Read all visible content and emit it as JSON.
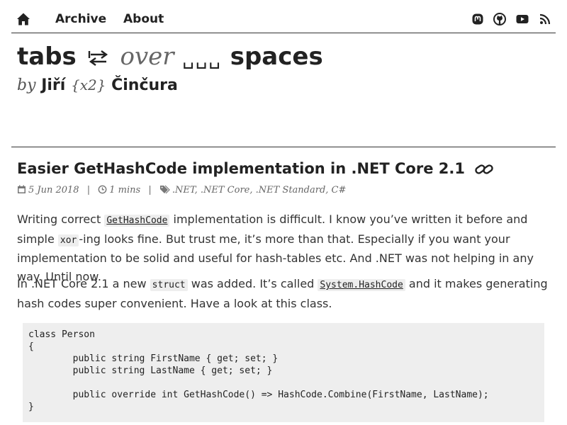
{
  "nav": {
    "home_icon": "home-icon",
    "links": [
      "Archive",
      "About"
    ],
    "social_icons": [
      "mastodon-icon",
      "github-icon",
      "youtube-icon",
      "rss-icon"
    ]
  },
  "site": {
    "title_part1": "tabs",
    "title_arrows": "⇆",
    "title_over": "over",
    "title_spaces_glyph": "␣␣␣",
    "title_part2": "spaces",
    "by": "by",
    "first_name": "Jiří",
    "nick": "{x2}",
    "last_name": "Činčura"
  },
  "post": {
    "title": "Easier GetHashCode implementation in .NET Core 2.1",
    "date": "5 Jun 2018",
    "read_time": "1 mins",
    "tags": ".NET, .NET Core, .NET Standard, C#",
    "para1": {
      "t1": "Writing correct ",
      "code1": "GetHashCode",
      "t2": " implementation is difficult. I know you’ve written it before and simple ",
      "code2": "xor",
      "t3": "-ing looks fine. But trust me, it’s more than that. Especially if you want your implementation to be solid and useful for hash-tables etc. And .NET was not helping in any way. Until now."
    },
    "para2": {
      "t1": "In .NET Core 2.1 a new ",
      "code1": "struct",
      "t2": " was added. It’s called ",
      "code2": "System.HashCode",
      "t3": " and it makes generating hash codes super convenient. Have a look at this class."
    },
    "code": "class Person\n{\n\tpublic string FirstName { get; set; }\n\tpublic string LastName { get; set; }\n\n\tpublic override int GetHashCode() => HashCode.Combine(FirstName, LastName);\n}"
  }
}
